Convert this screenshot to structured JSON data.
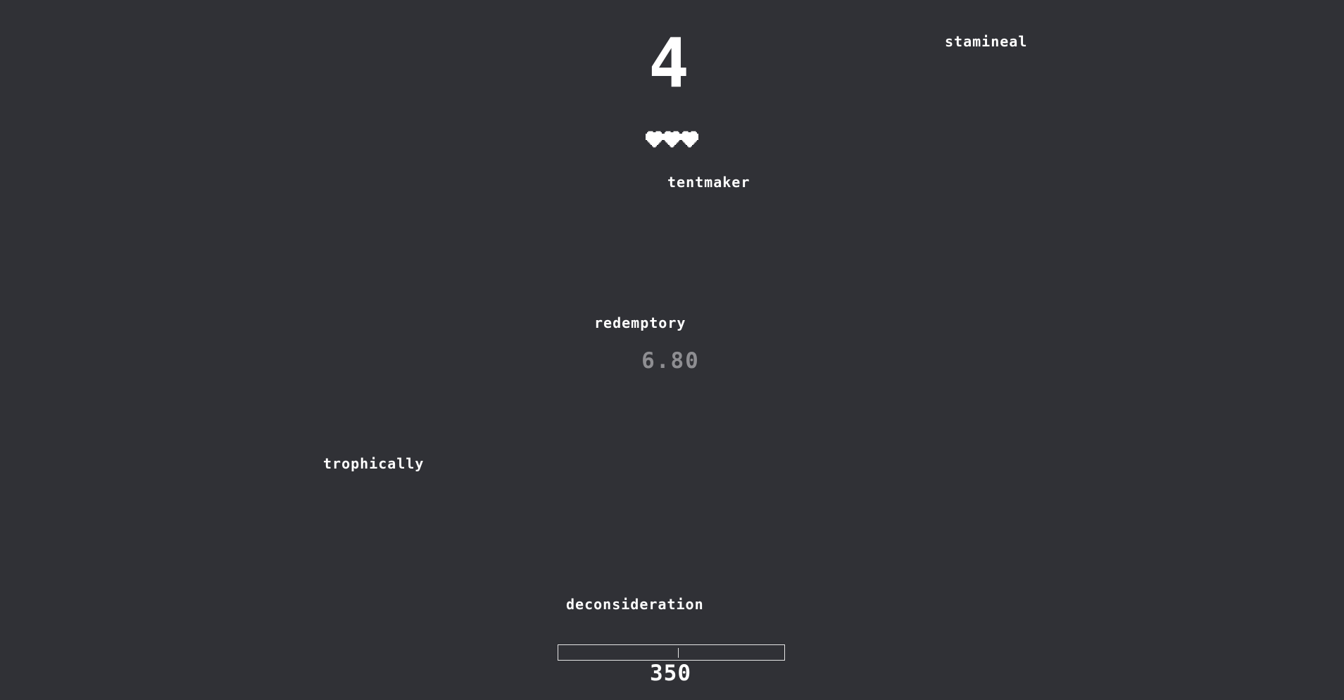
{
  "game": {
    "level": "4",
    "lives": 3,
    "timer": "6.80",
    "score": "350",
    "progress": 0.53
  },
  "words": {
    "w1": "stamineal",
    "w2": "tentmaker",
    "w3": "redemptory",
    "w4": "trophically",
    "w5": "deconsideration"
  },
  "colors": {
    "background": "#303136",
    "text": "#ffffff",
    "timer": "#8e8e92",
    "progress_border": "#e6e6e6"
  },
  "icons": {
    "life": "heart-icon"
  }
}
